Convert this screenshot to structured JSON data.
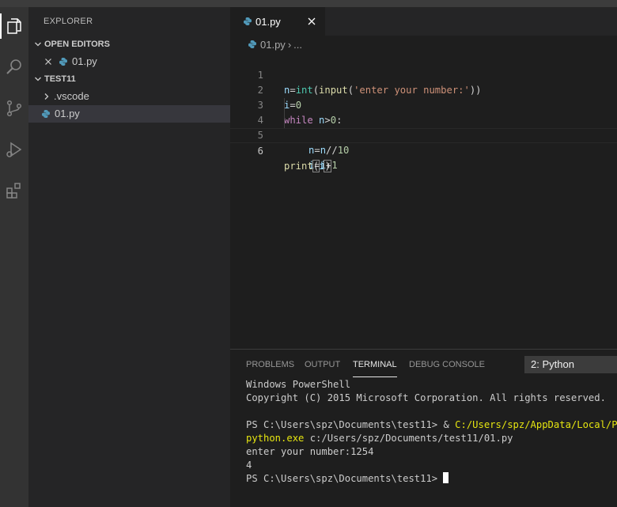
{
  "sidebar": {
    "title": "EXPLORER",
    "open_editors": {
      "label": "OPEN EDITORS",
      "files": [
        {
          "name": "01.py"
        }
      ]
    },
    "folder": {
      "label": "TEST11",
      "items": [
        {
          "name": ".vscode",
          "kind": "folder"
        },
        {
          "name": "01.py",
          "kind": "python-file",
          "selected": true
        }
      ]
    }
  },
  "editor": {
    "tab": {
      "label": "01.py"
    },
    "breadcrumb": {
      "file": "01.py",
      "sep": "›",
      "rest": "..."
    },
    "lines": [
      {
        "n": "1"
      },
      {
        "n": "2"
      },
      {
        "n": "3"
      },
      {
        "n": "4"
      },
      {
        "n": "5"
      },
      {
        "n": "6"
      }
    ]
  },
  "panel": {
    "tabs": [
      "PROBLEMS",
      "OUTPUT",
      "TERMINAL",
      "DEBUG CONSOLE"
    ],
    "active_tab": "TERMINAL",
    "terminal_select": "2: Python",
    "terminal": {
      "l1": "Windows PowerShell",
      "l2": "Copyright (C) 2015 Microsoft Corporation. All rights reserved.",
      "l3_prompt": "PS C:\\Users\\spz\\Documents\\test11> & ",
      "l3_path": "C:/Users/spz/AppData/Local/Prog",
      "l4_exe": "python.exe",
      "l4_rest": " c:/Users/spz/Documents/test11/01.py",
      "l5": "enter your number:1254",
      "l6": "4",
      "l7_prompt": "PS C:\\Users\\spz\\Documents\\test11> "
    }
  },
  "colors": {
    "activity_bar": "#333333",
    "sidebar": "#252526",
    "editor": "#1e1e1e",
    "python_icon": "#519aba"
  }
}
